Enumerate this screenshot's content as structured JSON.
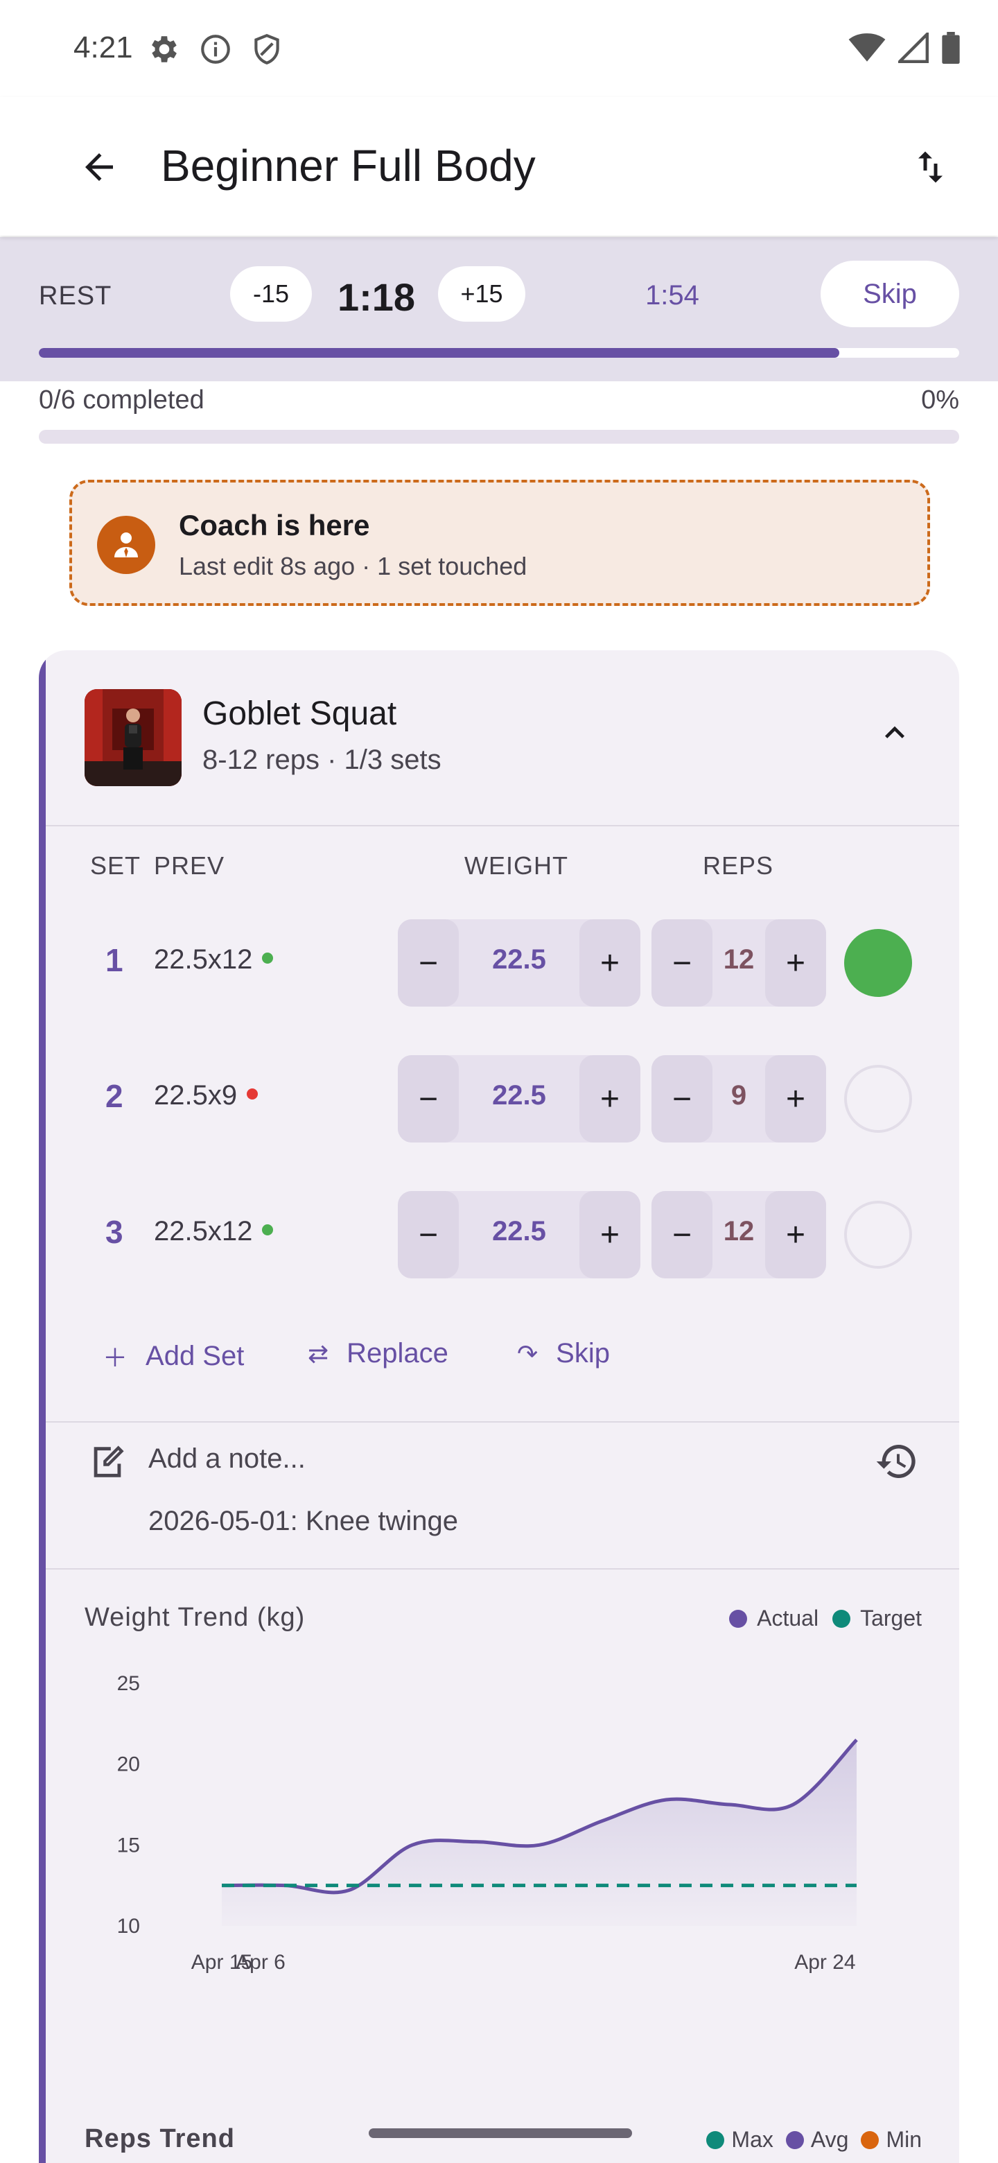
{
  "status_bar": {
    "time": "4:21",
    "left_icons": [
      "gear-icon",
      "info-icon",
      "shield-icon"
    ],
    "right_icons": [
      "wifi-icon",
      "signal-icon",
      "battery-icon"
    ]
  },
  "app_bar": {
    "title": "Beginner Full Body",
    "back_icon": "arrow-left-icon",
    "action_icon": "swap-vertical-icon"
  },
  "rest_timer": {
    "label": "REST",
    "minus_label": "-15",
    "time_remaining": "1:18",
    "plus_label": "+15",
    "total_time": "1:54",
    "skip_label": "Skip",
    "progress_fraction": 0.87
  },
  "workout_progress": {
    "text": "0/6 completed",
    "percent_text": "0%",
    "fraction": 0.0
  },
  "coach_banner": {
    "title": "Coach is here",
    "subtitle": "Last edit 8s ago · 1 set touched",
    "icon": "coach-person-icon"
  },
  "exercise": {
    "name": "Goblet Squat",
    "meta": "8-12 reps · 1/3 sets",
    "collapse_icon": "chevron-up-icon",
    "columns": {
      "set": "SET",
      "prev": "PREV",
      "weight": "WEIGHT",
      "reps": "REPS"
    },
    "sets": [
      {
        "num": "1",
        "prev": "22.5x12",
        "prev_status": "good",
        "weight": "22.5",
        "reps": "12",
        "done": true
      },
      {
        "num": "2",
        "prev": "22.5x9",
        "prev_status": "bad",
        "weight": "22.5",
        "reps": "9",
        "done": false
      },
      {
        "num": "3",
        "prev": "22.5x12",
        "prev_status": "good",
        "weight": "22.5",
        "reps": "12",
        "done": false
      }
    ],
    "stepper_minus": "−",
    "stepper_plus": "+",
    "actions": {
      "add_set": "Add Set",
      "replace": "Replace",
      "skip": "Skip"
    },
    "note": {
      "placeholder": "Add a note...",
      "history": "2026-05-01: Knee twinge"
    }
  },
  "colors": {
    "primary": "#6750a4",
    "target": "#0f8a7a",
    "good": "#4caf50",
    "bad": "#e53935",
    "coach": "#c85d12",
    "min": "#d9650f"
  },
  "chart_data": [
    {
      "type": "area",
      "title": "Weight Trend (kg)",
      "legend": [
        "Actual",
        "Target"
      ],
      "legend_position": "top-right",
      "ylim": [
        10,
        25
      ],
      "y_ticks": [
        "25",
        "20",
        "15",
        "10"
      ],
      "x_ticks": [
        "Apr 6",
        "Apr 15",
        "Apr 24"
      ],
      "x": [
        "Apr 6",
        "Apr 8",
        "Apr 10",
        "Apr 12",
        "Apr 14",
        "Apr 16",
        "Apr 18",
        "Apr 20",
        "Apr 22",
        "Apr 24",
        "Apr 25"
      ],
      "series": [
        {
          "name": "Actual",
          "values": [
            12.5,
            12.5,
            12.2,
            15.0,
            15.2,
            15.0,
            16.5,
            17.8,
            17.5,
            17.5,
            21.5
          ]
        },
        {
          "name": "Target",
          "values": [
            12.5,
            12.5,
            12.5,
            12.5,
            12.5,
            12.5,
            12.5,
            12.5,
            12.5,
            12.5,
            12.5
          ]
        }
      ]
    },
    {
      "type": "line",
      "title": "Reps Trend",
      "legend": [
        "Max",
        "Avg",
        "Min"
      ],
      "legend_position": "top-right"
    }
  ]
}
